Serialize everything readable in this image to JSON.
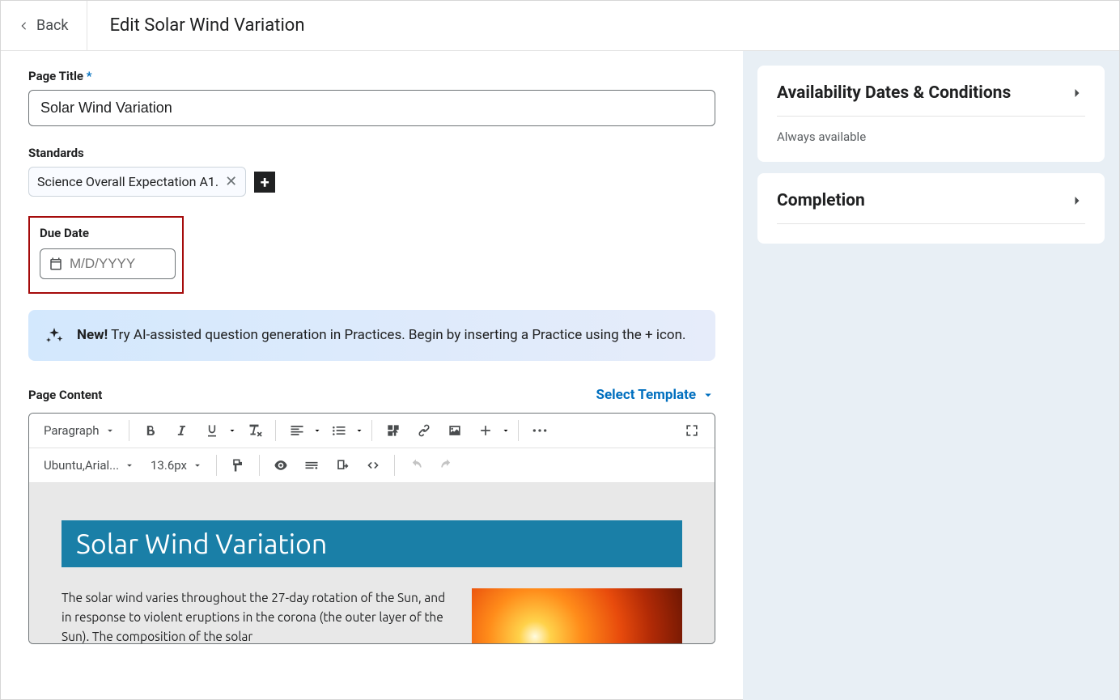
{
  "header": {
    "back_label": "Back",
    "page_title": "Edit Solar Wind Variation"
  },
  "form": {
    "page_title_label": "Page Title",
    "required_mark": "*",
    "page_title_value": "Solar Wind Variation",
    "standards_label": "Standards",
    "standards_tag": "Science Overall Expectation A1.",
    "due_date_label": "Due Date",
    "due_date_placeholder": "M/D/YYYY"
  },
  "banner": {
    "new_label": "New!",
    "text": "Try AI-assisted question generation in Practices. Begin by inserting a Practice using the + icon."
  },
  "content": {
    "label": "Page Content",
    "select_template": "Select Template"
  },
  "toolbar": {
    "block": "Paragraph",
    "font": "Ubuntu,Arial...",
    "size": "13.6px"
  },
  "document": {
    "title": "Solar Wind Variation",
    "body": "The solar wind varies throughout the 27-day rotation of the Sun, and in response to violent eruptions in the corona (the outer layer of the Sun). The composition of the solar"
  },
  "sidebar": {
    "availability_title": "Availability Dates & Conditions",
    "availability_status": "Always available",
    "completion_title": "Completion"
  }
}
